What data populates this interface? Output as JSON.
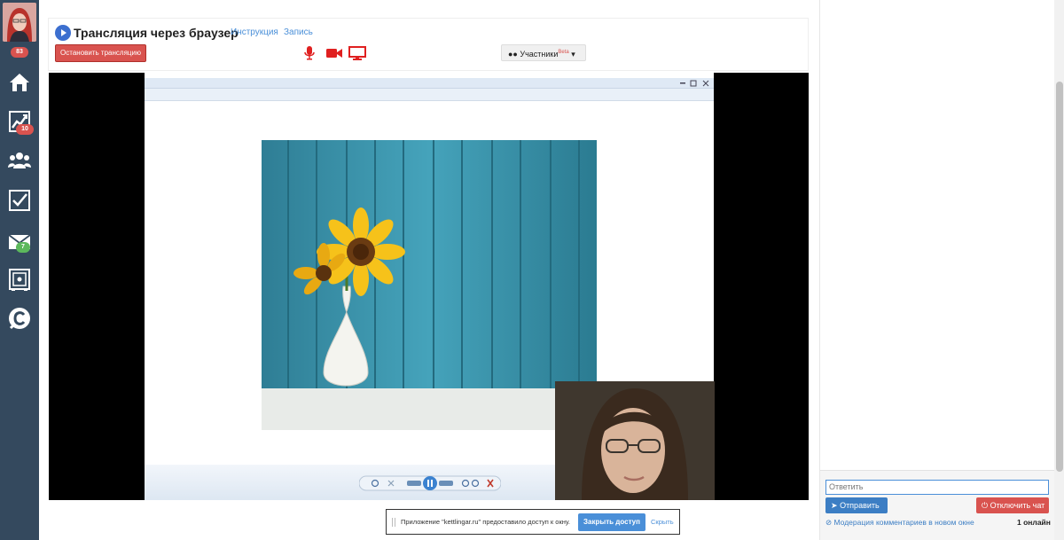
{
  "sidebar": {
    "avatar_badge": "83",
    "items": [
      {
        "icon": "home-icon"
      },
      {
        "icon": "chart-icon",
        "badge": "10",
        "badge_color": "#d9534f"
      },
      {
        "icon": "users-icon"
      },
      {
        "icon": "checkbox-icon"
      },
      {
        "icon": "mail-icon",
        "badge": "7",
        "badge_color": "#5cb85c"
      },
      {
        "icon": "safe-icon"
      },
      {
        "icon": "logo-icon"
      }
    ],
    "colors": {
      "bg": "#34495e",
      "icon": "#ffffff"
    }
  },
  "header": {
    "title": "Трансляция через браузер",
    "links": [
      "Инструкция",
      "Запись"
    ],
    "stop_button": "Остановить трансляцию",
    "controls": [
      "microphone-icon",
      "camera-icon",
      "screen-share-icon"
    ],
    "controls_color": "#e02020",
    "participants": {
      "label": "Участники",
      "tag": "Beta"
    }
  },
  "notice": {
    "message": "Приложение \"kettlingar.ru\" предоставило доступ к окну.",
    "close_access": "Закрыть доступ",
    "hide": "Скрыть"
  },
  "chat": {
    "reply_placeholder": "Ответить",
    "send_button": "Отправить",
    "disable_button": "Отключить чат",
    "moderation_link": "Модерация комментариев в новом окне",
    "online": "1 онлайн"
  }
}
